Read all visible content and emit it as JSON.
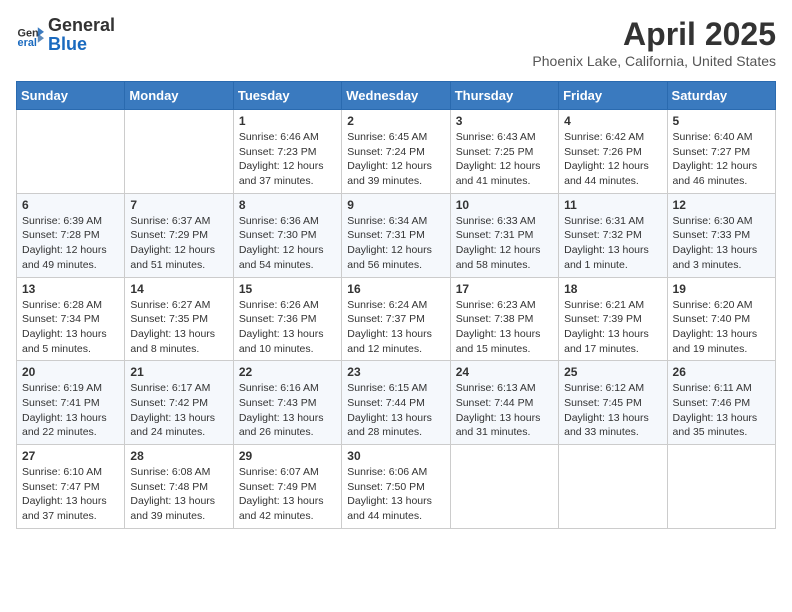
{
  "header": {
    "logo_general": "General",
    "logo_blue": "Blue",
    "title": "April 2025",
    "subtitle": "Phoenix Lake, California, United States"
  },
  "weekdays": [
    "Sunday",
    "Monday",
    "Tuesday",
    "Wednesday",
    "Thursday",
    "Friday",
    "Saturday"
  ],
  "weeks": [
    [
      {
        "day": "",
        "info": ""
      },
      {
        "day": "",
        "info": ""
      },
      {
        "day": "1",
        "info": "Sunrise: 6:46 AM\nSunset: 7:23 PM\nDaylight: 12 hours and 37 minutes."
      },
      {
        "day": "2",
        "info": "Sunrise: 6:45 AM\nSunset: 7:24 PM\nDaylight: 12 hours and 39 minutes."
      },
      {
        "day": "3",
        "info": "Sunrise: 6:43 AM\nSunset: 7:25 PM\nDaylight: 12 hours and 41 minutes."
      },
      {
        "day": "4",
        "info": "Sunrise: 6:42 AM\nSunset: 7:26 PM\nDaylight: 12 hours and 44 minutes."
      },
      {
        "day": "5",
        "info": "Sunrise: 6:40 AM\nSunset: 7:27 PM\nDaylight: 12 hours and 46 minutes."
      }
    ],
    [
      {
        "day": "6",
        "info": "Sunrise: 6:39 AM\nSunset: 7:28 PM\nDaylight: 12 hours and 49 minutes."
      },
      {
        "day": "7",
        "info": "Sunrise: 6:37 AM\nSunset: 7:29 PM\nDaylight: 12 hours and 51 minutes."
      },
      {
        "day": "8",
        "info": "Sunrise: 6:36 AM\nSunset: 7:30 PM\nDaylight: 12 hours and 54 minutes."
      },
      {
        "day": "9",
        "info": "Sunrise: 6:34 AM\nSunset: 7:31 PM\nDaylight: 12 hours and 56 minutes."
      },
      {
        "day": "10",
        "info": "Sunrise: 6:33 AM\nSunset: 7:31 PM\nDaylight: 12 hours and 58 minutes."
      },
      {
        "day": "11",
        "info": "Sunrise: 6:31 AM\nSunset: 7:32 PM\nDaylight: 13 hours and 1 minute."
      },
      {
        "day": "12",
        "info": "Sunrise: 6:30 AM\nSunset: 7:33 PM\nDaylight: 13 hours and 3 minutes."
      }
    ],
    [
      {
        "day": "13",
        "info": "Sunrise: 6:28 AM\nSunset: 7:34 PM\nDaylight: 13 hours and 5 minutes."
      },
      {
        "day": "14",
        "info": "Sunrise: 6:27 AM\nSunset: 7:35 PM\nDaylight: 13 hours and 8 minutes."
      },
      {
        "day": "15",
        "info": "Sunrise: 6:26 AM\nSunset: 7:36 PM\nDaylight: 13 hours and 10 minutes."
      },
      {
        "day": "16",
        "info": "Sunrise: 6:24 AM\nSunset: 7:37 PM\nDaylight: 13 hours and 12 minutes."
      },
      {
        "day": "17",
        "info": "Sunrise: 6:23 AM\nSunset: 7:38 PM\nDaylight: 13 hours and 15 minutes."
      },
      {
        "day": "18",
        "info": "Sunrise: 6:21 AM\nSunset: 7:39 PM\nDaylight: 13 hours and 17 minutes."
      },
      {
        "day": "19",
        "info": "Sunrise: 6:20 AM\nSunset: 7:40 PM\nDaylight: 13 hours and 19 minutes."
      }
    ],
    [
      {
        "day": "20",
        "info": "Sunrise: 6:19 AM\nSunset: 7:41 PM\nDaylight: 13 hours and 22 minutes."
      },
      {
        "day": "21",
        "info": "Sunrise: 6:17 AM\nSunset: 7:42 PM\nDaylight: 13 hours and 24 minutes."
      },
      {
        "day": "22",
        "info": "Sunrise: 6:16 AM\nSunset: 7:43 PM\nDaylight: 13 hours and 26 minutes."
      },
      {
        "day": "23",
        "info": "Sunrise: 6:15 AM\nSunset: 7:44 PM\nDaylight: 13 hours and 28 minutes."
      },
      {
        "day": "24",
        "info": "Sunrise: 6:13 AM\nSunset: 7:44 PM\nDaylight: 13 hours and 31 minutes."
      },
      {
        "day": "25",
        "info": "Sunrise: 6:12 AM\nSunset: 7:45 PM\nDaylight: 13 hours and 33 minutes."
      },
      {
        "day": "26",
        "info": "Sunrise: 6:11 AM\nSunset: 7:46 PM\nDaylight: 13 hours and 35 minutes."
      }
    ],
    [
      {
        "day": "27",
        "info": "Sunrise: 6:10 AM\nSunset: 7:47 PM\nDaylight: 13 hours and 37 minutes."
      },
      {
        "day": "28",
        "info": "Sunrise: 6:08 AM\nSunset: 7:48 PM\nDaylight: 13 hours and 39 minutes."
      },
      {
        "day": "29",
        "info": "Sunrise: 6:07 AM\nSunset: 7:49 PM\nDaylight: 13 hours and 42 minutes."
      },
      {
        "day": "30",
        "info": "Sunrise: 6:06 AM\nSunset: 7:50 PM\nDaylight: 13 hours and 44 minutes."
      },
      {
        "day": "",
        "info": ""
      },
      {
        "day": "",
        "info": ""
      },
      {
        "day": "",
        "info": ""
      }
    ]
  ]
}
